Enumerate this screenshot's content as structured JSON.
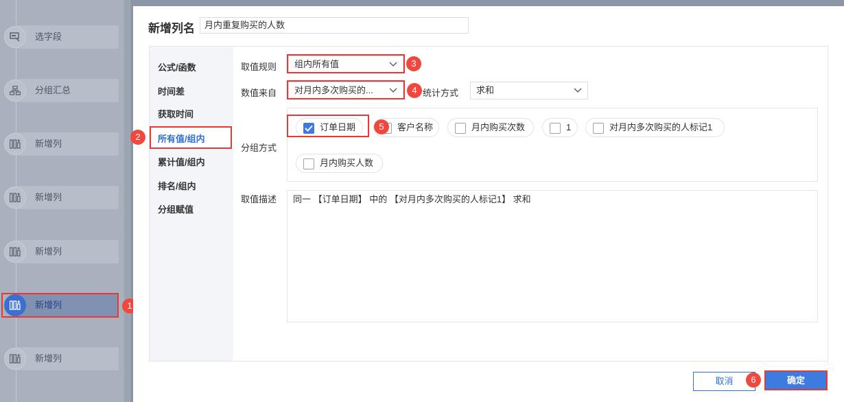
{
  "steps": [
    {
      "label": "选字段",
      "icon": "select-field-icon"
    },
    {
      "label": "分组汇总",
      "icon": "group-summary-icon"
    },
    {
      "label": "新增列",
      "icon": "add-column-icon"
    },
    {
      "label": "新增列",
      "icon": "add-column-icon"
    },
    {
      "label": "新增列",
      "icon": "add-column-icon"
    },
    {
      "label": "新增列",
      "icon": "add-column-icon"
    },
    {
      "label": "新增列",
      "icon": "add-column-icon"
    }
  ],
  "dialog": {
    "title_label": "新增列名",
    "title_value": "月内重复购买的人数"
  },
  "menu": {
    "items": [
      "公式/函数",
      "时间差",
      "获取时间",
      "所有值/组内",
      "累计值/组内",
      "排名/组内",
      "分组赋值"
    ],
    "active": "所有值/组内"
  },
  "form": {
    "rule_label": "取值规则",
    "rule_value": "组内所有值",
    "source_label": "数值来自",
    "source_value": "对月内多次购买的...",
    "stat_label": "统计方式",
    "stat_value": "求和",
    "group_label": "分组方式",
    "group_options": [
      {
        "label": "订单日期",
        "checked": true
      },
      {
        "label": "客户名称",
        "checked": false
      },
      {
        "label": "月内购买次数",
        "checked": false
      },
      {
        "label": "1",
        "checked": false
      },
      {
        "label": "对月内多次购买的人标记1",
        "checked": false
      },
      {
        "label": "月内购买人数",
        "checked": false
      }
    ],
    "desc_label": "取值描述",
    "desc_value": "同一 【订单日期】 中的 【对月内多次购买的人标记1】 求和"
  },
  "buttons": {
    "cancel": "取消",
    "ok": "确定"
  },
  "badges": [
    "1",
    "2",
    "3",
    "4",
    "5",
    "6"
  ],
  "colors": {
    "accent": "#3d7be0",
    "highlight": "#e53935",
    "badge": "#f0483e"
  }
}
